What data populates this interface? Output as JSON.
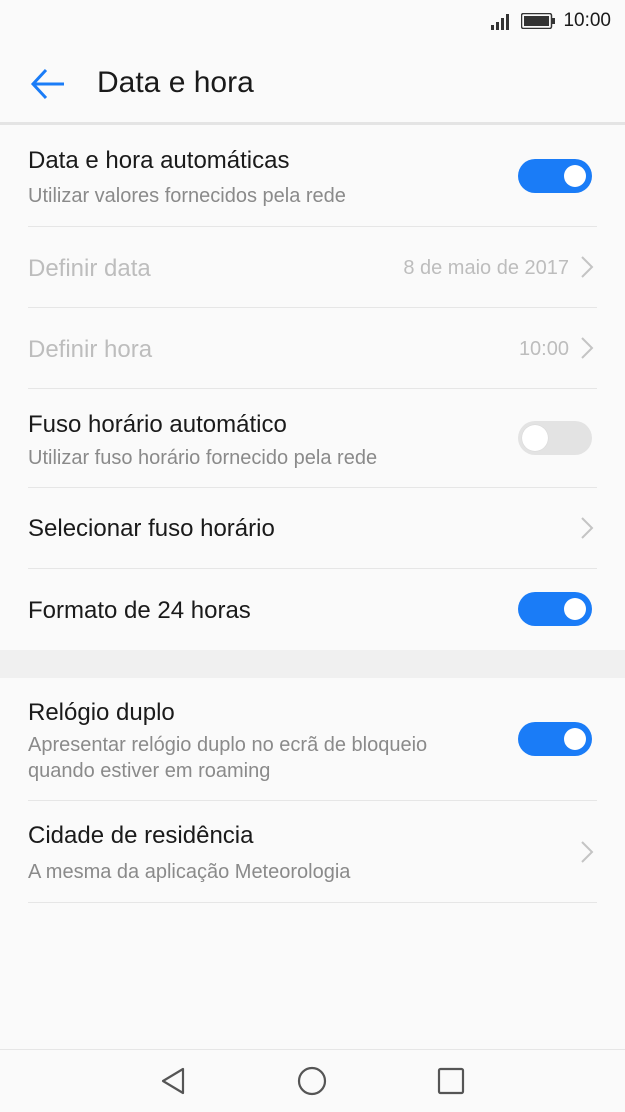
{
  "status_bar": {
    "time": "10:00",
    "signal_icon": "cell-signal-icon",
    "battery_icon": "battery-icon"
  },
  "header": {
    "title": "Data e hora",
    "back_icon": "arrow-left-icon"
  },
  "colors": {
    "accent": "#1a7cf7",
    "toggle_off": "#e3e3e3",
    "disabled_text": "#bdbdbd",
    "secondary_text": "#8a8a8a"
  },
  "settings": {
    "auto_datetime": {
      "label": "Data e hora automáticas",
      "sub": "Utilizar valores fornecidos pela rede",
      "enabled": true
    },
    "set_date": {
      "label": "Definir data",
      "value": "8 de maio de 2017"
    },
    "set_time": {
      "label": "Definir hora",
      "value": "10:00"
    },
    "auto_timezone": {
      "label": "Fuso horário automático",
      "sub": "Utilizar fuso horário fornecido pela rede",
      "enabled": false
    },
    "select_timezone": {
      "label": "Selecionar fuso horário"
    },
    "format_24h": {
      "label": "Formato de 24 horas",
      "enabled": true
    },
    "dual_clock": {
      "label": "Relógio duplo",
      "sub": "Apresentar relógio duplo no ecrã de bloqueio quando estiver em roaming",
      "enabled": true
    },
    "home_city": {
      "label": "Cidade de residência",
      "sub": "A mesma da aplicação Meteorologia"
    }
  },
  "nav_bar": {
    "back_icon": "triangle-back-icon",
    "home_icon": "circle-home-icon",
    "recents_icon": "square-recents-icon"
  }
}
